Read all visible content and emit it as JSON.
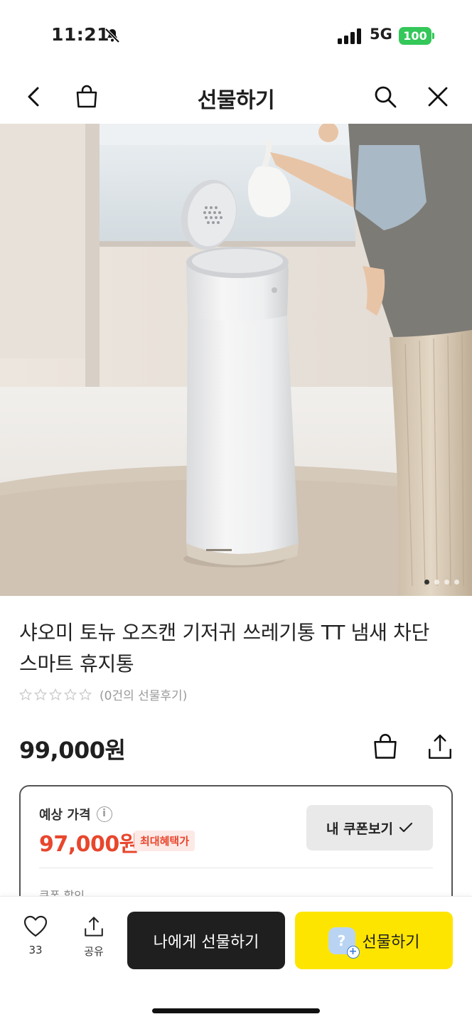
{
  "status_bar": {
    "time": "11:21",
    "network": "5G",
    "battery": "100",
    "silent_icon": "bell-slash-icon",
    "signal_icon": "signal-bars-icon"
  },
  "header": {
    "title": "선물하기",
    "back_icon": "chevron-left-icon",
    "bag_icon": "shopping-bag-icon",
    "search_icon": "search-icon",
    "close_icon": "close-icon"
  },
  "hero": {
    "image_count": 4,
    "active_index": 0
  },
  "product": {
    "title": "샤오미 토뉴 오즈캔 기저귀 쓰레기통 TT 냄새 차단 스마트 휴지통",
    "rating": 0,
    "rating_max": 5,
    "review_text": "(0건의 선물후기)",
    "price": "99,000원"
  },
  "price_card": {
    "expected_label": "예상 가격",
    "expected_price": "97,000원",
    "max_badge": "최대혜택가",
    "coupon_button": "내 쿠폰보기",
    "coupon_discount_label": "쿠폰 할인"
  },
  "bottom_bar": {
    "like_count": "33",
    "share_label": "공유",
    "self_gift": "나에게 선물하기",
    "gift": "선물하기",
    "gift_avatar_glyph": "?"
  },
  "colors": {
    "accent_price": "#e8462d",
    "gift_button": "#fee500",
    "self_button": "#1f1f1f",
    "battery": "#34c759"
  }
}
